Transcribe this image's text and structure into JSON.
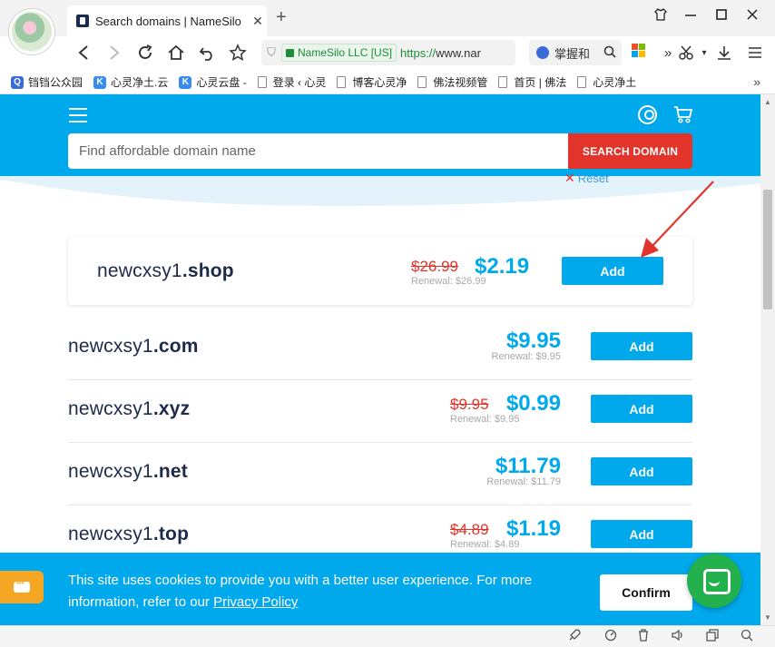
{
  "browser": {
    "tab_title": "Search domains | NameSilo",
    "tab_close": "✕",
    "new_tab": "+",
    "address": {
      "ev_label": "NameSilo LLC [US]",
      "url_scheme": "https://",
      "url_rest": "www.nar"
    },
    "search_engine_text": "掌握和",
    "bookmarks": [
      {
        "label": "铛铛公众园",
        "icon": "q-icon",
        "color": "#3a6cd8",
        "glyph": "Q"
      },
      {
        "label": "心灵净土.云",
        "icon": "k-icon",
        "color": "#3a8bf0",
        "glyph": "K"
      },
      {
        "label": "心灵云盘 -",
        "icon": "k-icon",
        "color": "#3a8bf0",
        "glyph": "K"
      },
      {
        "label": "登录 ‹ 心灵",
        "icon": "page-icon"
      },
      {
        "label": "博客心灵净",
        "icon": "page-icon"
      },
      {
        "label": "佛法视频管",
        "icon": "page-icon"
      },
      {
        "label": "首页 | 佛法",
        "icon": "page-icon"
      },
      {
        "label": "心灵净土",
        "icon": "page-icon"
      }
    ],
    "bookmarks_more": "»"
  },
  "site": {
    "search_placeholder": "Find affordable domain name",
    "search_button": "SEARCH DOMAIN",
    "reset_label": "Reset",
    "featured": {
      "sld": "newcxsy1",
      "tld": ".shop",
      "old_price": "$26.99",
      "price": "$2.19",
      "renewal": "Renewal: $26.99",
      "add_label": "Add"
    },
    "results": [
      {
        "sld": "newcxsy1",
        "tld": ".com",
        "old_price": "",
        "price": "$9.95",
        "renewal": "Renewal: $9.95",
        "add_label": "Add"
      },
      {
        "sld": "newcxsy1",
        "tld": ".xyz",
        "old_price": "$9.95",
        "price": "$0.99",
        "renewal": "Renewal: $9.95",
        "add_label": "Add"
      },
      {
        "sld": "newcxsy1",
        "tld": ".net",
        "old_price": "",
        "price": "$11.79",
        "renewal": "Renewal: $11.79",
        "add_label": "Add"
      },
      {
        "sld": "newcxsy1",
        "tld": ".top",
        "old_price": "$4.89",
        "price": "$1.19",
        "renewal": "Renewal: $4.89",
        "add_label": "Add"
      }
    ],
    "cookie": {
      "text": "This site uses cookies to provide you with a better user experience. For more information, refer to our ",
      "link": "Privacy Policy",
      "confirm": "Confirm"
    },
    "colors": {
      "brand_blue": "#00a8ec",
      "search_red": "#e2342a",
      "old_price_red": "#e2342a",
      "chat_orange": "#f5a623",
      "intercom_green": "#22b14c"
    }
  }
}
